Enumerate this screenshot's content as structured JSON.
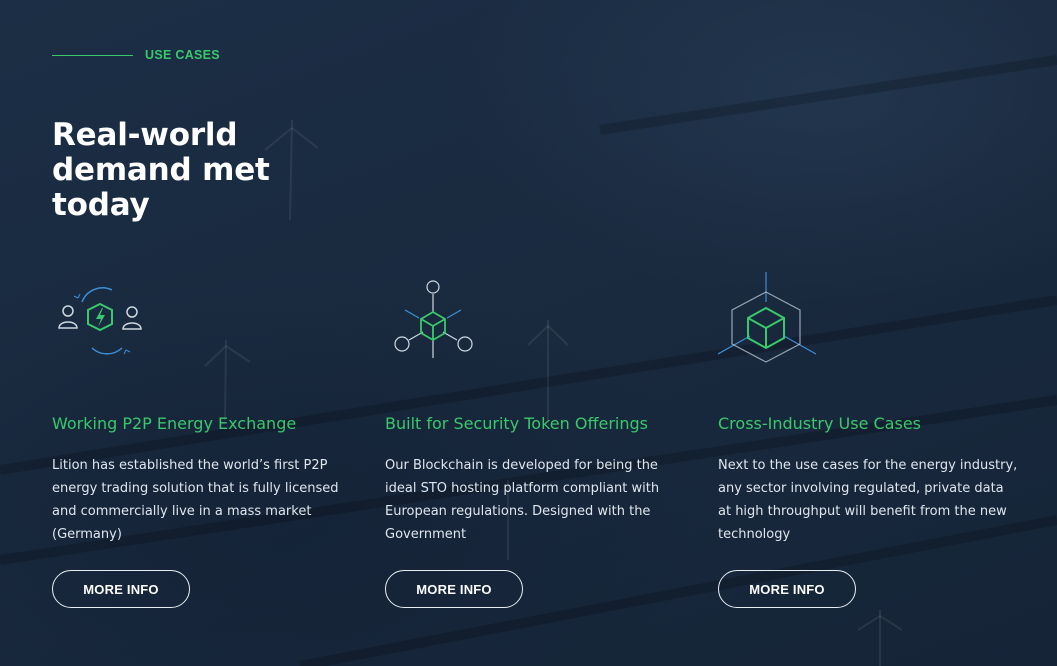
{
  "section": {
    "eyebrow": "USE CASES",
    "headline": "Real-world demand met today"
  },
  "cards": [
    {
      "title": "Working P2P Energy Exchange",
      "body": "Lition has established the world’s first P2P energy trading solution that is fully licensed and commercially live in a mass market (Germany)",
      "button": "MORE INFO",
      "icon": "p2p-energy-exchange-icon"
    },
    {
      "title": "Built for Security Token Offerings",
      "body": "Our Blockchain is developed for being the ideal STO hosting platform compliant with European regulations. Designed with the Government",
      "button": "MORE INFO",
      "icon": "blockchain-network-icon"
    },
    {
      "title": "Cross-Industry Use Cases",
      "body": "Next to the use cases for the energy industry, any sector involving regulated, private data at high throughput will benefit from the new technology",
      "button": "MORE INFO",
      "icon": "cube-hexagon-icon"
    }
  ],
  "colors": {
    "accent_green": "#39c96b",
    "background": "#1a2b40",
    "text": "#e8edf3"
  }
}
